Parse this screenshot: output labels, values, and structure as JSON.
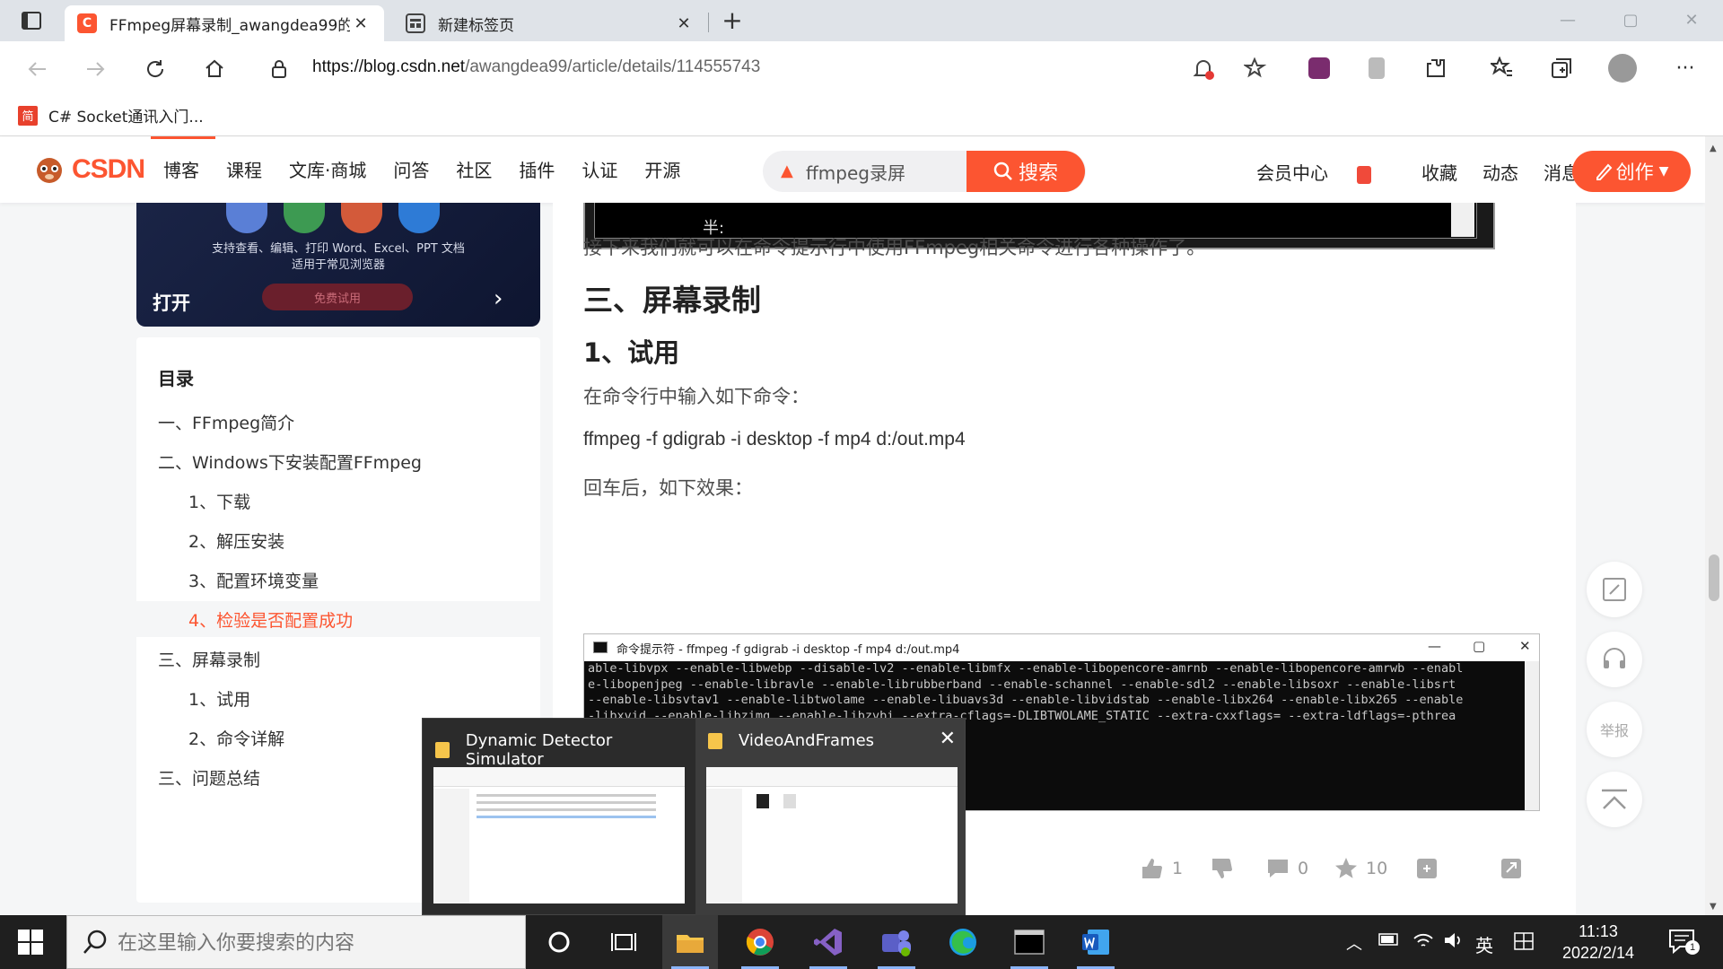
{
  "browser": {
    "tabs": [
      {
        "title": "FFmpeg屏幕录制_awangdea99的",
        "favicon": "C",
        "close": "✕"
      },
      {
        "title": "新建标签页",
        "close": "✕"
      }
    ],
    "new_tab": "+",
    "window_controls": {
      "minimize": "—",
      "maximize": "▢",
      "close": "✕"
    },
    "url_host": "https://blog.csdn.net",
    "url_path": "/awangdea99/article/details/114555743",
    "bookmark": {
      "icon_text": "简",
      "label": "C# Socket通讯入门..."
    }
  },
  "csdn": {
    "logo_text": "CSDN",
    "nav": [
      "博客",
      "课程",
      "文库·商城",
      "问答",
      "社区",
      "插件",
      "认证",
      "开源"
    ],
    "search_value": "ffmpeg录屏",
    "search_button": "搜索",
    "user_nav": [
      "会员中心",
      "收藏",
      "动态",
      "消息"
    ],
    "create_button": "创作"
  },
  "ad": {
    "line1": "支持查看、编辑、打印 Word、Excel、PPT 文档",
    "line2": "适用于常见浏览器",
    "open": "打开",
    "pill": "免费试用"
  },
  "toc": {
    "title": "目录",
    "items": [
      {
        "text": "一、FFmpeg简介",
        "level": 1,
        "active": false
      },
      {
        "text": "二、Windows下安装配置FFmpeg",
        "level": 1,
        "active": false
      },
      {
        "text": "1、下载",
        "level": 2,
        "active": false
      },
      {
        "text": "2、解压安装",
        "level": 2,
        "active": false
      },
      {
        "text": "3、配置环境变量",
        "level": 2,
        "active": false
      },
      {
        "text": "4、检验是否配置成功",
        "level": 2,
        "active": true
      },
      {
        "text": "三、屏幕录制",
        "level": 1,
        "active": false
      },
      {
        "text": "1、试用",
        "level": 2,
        "active": false
      },
      {
        "text": "2、命令详解",
        "level": 2,
        "active": false
      },
      {
        "text": "三、问题总结",
        "level": 1,
        "active": false
      }
    ]
  },
  "article": {
    "top_image_text": "半:",
    "para1": "接下来我们就可以在命令提示行中使用FFmpeg相关命令进行各种操作了。",
    "h2": "三、屏幕录制",
    "h3": "1、试用",
    "para2": "在命令行中输入如下命令：",
    "code": "ffmpeg -f gdigrab -i desktop -f mp4 d:/out.mp4",
    "para3": "回车后，如下效果：",
    "cmd_title": "命令提示符 - ffmpeg  -f gdigrab -i desktop -f mp4 d:/out.mp4",
    "cmd_lines": [
      "able-libvpx --enable-libwebp --disable-lv2 --enable-libmfx --enable-libopencore-amrnb --enable-libopencore-amrwb --enabl",
      "e-libopenjpeg --enable-libravle --enable-librubberband --enable-schannel --enable-sdl2 --enable-libsoxr --enable-libsrt ",
      "--enable-libsvtav1 --enable-libtwolame --enable-libuavs3d --enable-libvidstab --enable-libx264 --enable-libx265 --enable",
      "-libxvid --enable-libzimg --enable-libzvbi --extra-cflags=-DLIBTWOLAME_STATIC --extra-cxxflags= --extra-ldflags=-pthrea"
    ]
  },
  "actions": {
    "like": "1",
    "comment": "0",
    "favorite": "10"
  },
  "floating": {
    "report": "举报"
  },
  "thumbnails": [
    {
      "title": "Dynamic Detector Simulator"
    },
    {
      "title": "VideoAndFrames",
      "close": "✕"
    }
  ],
  "taskbar": {
    "search_placeholder": "在这里输入你要搜索的内容",
    "ime": "英",
    "time": "11:13",
    "date": "2022/2/14",
    "notifications": "1"
  }
}
